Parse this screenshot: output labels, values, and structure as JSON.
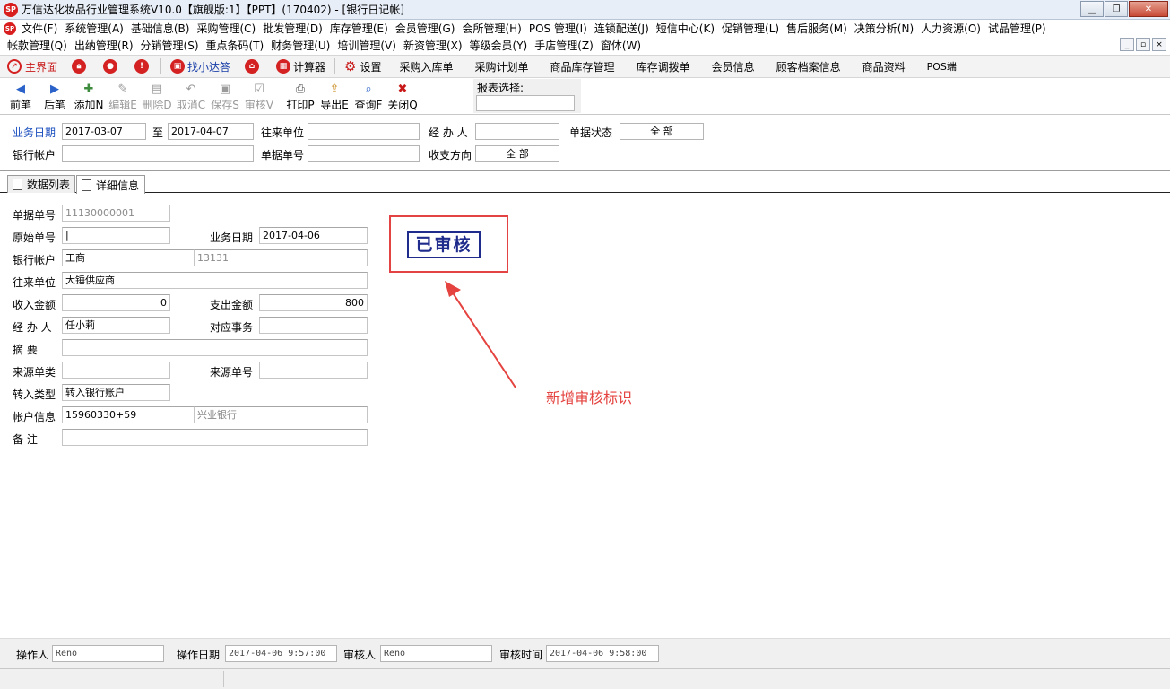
{
  "window": {
    "title": "万信达化妆品行业管理系统V10.0【旗舰版:1】【PPT】(170402) - [银行日记帐]",
    "logo_text": "SP",
    "min_glyph": "▁",
    "restore_glyph": "❐",
    "close_glyph": "✕"
  },
  "menu_row1": [
    "文件(F)",
    "系统管理(A)",
    "基础信息(B)",
    "采购管理(C)",
    "批发管理(D)",
    "库存管理(E)",
    "会员管理(G)",
    "会所管理(H)",
    "POS 管理(I)",
    "连锁配送(J)",
    "短信中心(K)",
    "促销管理(L)",
    "售后服务(M)",
    "决策分析(N)",
    "人力资源(O)",
    "试品管理(P)"
  ],
  "menu_row2": [
    "帐款管理(Q)",
    "出纳管理(R)",
    "分销管理(S)",
    "重点条码(T)",
    "财务管理(U)",
    "培训管理(V)",
    "新资管理(X)",
    "等级会员(Y)",
    "手店管理(Z)",
    "窗体(W)"
  ],
  "mdi": {
    "min": "_",
    "restore": "▫",
    "close": "×"
  },
  "quickbar": {
    "main": "主界面",
    "find": "找小达答",
    "calc": "计算器",
    "settings": "设置",
    "links": [
      "采购入库单",
      "采购计划单",
      "商品库存管理",
      "库存调拨单",
      "会员信息",
      "顾客档案信息",
      "商品资料",
      "POS端"
    ]
  },
  "toolbar": {
    "buttons": [
      {
        "label": "前笔",
        "icon": "◀",
        "enabled": true,
        "color": "#2a62c9"
      },
      {
        "label": "后笔",
        "icon": "▶",
        "enabled": true,
        "color": "#2a62c9"
      },
      {
        "label": "添加N",
        "icon": "✚",
        "enabled": true,
        "color": "#3d8b3d"
      },
      {
        "label": "编辑E",
        "icon": "✎",
        "enabled": false,
        "color": "#9a9a9a"
      },
      {
        "label": "删除D",
        "icon": "▤",
        "enabled": false,
        "color": "#9a9a9a"
      },
      {
        "label": "取消C",
        "icon": "↶",
        "enabled": false,
        "color": "#9a9a9a"
      },
      {
        "label": "保存S",
        "icon": "▣",
        "enabled": false,
        "color": "#9a9a9a"
      },
      {
        "label": "审核V",
        "icon": "☑",
        "enabled": false,
        "color": "#9a9a9a"
      },
      {
        "label": "打印P",
        "icon": "⎙",
        "enabled": true,
        "color": "#4a4a4a"
      },
      {
        "label": "导出E",
        "icon": "⇪",
        "enabled": true,
        "color": "#c98a1d"
      },
      {
        "label": "查询F",
        "icon": "⌕",
        "enabled": true,
        "color": "#2a62c9"
      },
      {
        "label": "关闭Q",
        "icon": "✖",
        "enabled": true,
        "color": "#c81818"
      }
    ],
    "report_label": "报表选择:"
  },
  "filters": {
    "date_label": "业务日期",
    "date_from": "2017-03-07",
    "to_label": "至",
    "date_to": "2017-04-07",
    "partner_label": "往来单位",
    "partner_value": "",
    "handler_label": "经 办 人",
    "handler_value": "",
    "status_label": "单据状态",
    "status_value": "全  部",
    "bank_label": "银行帐户",
    "bank_value": "",
    "docno_label": "单据单号",
    "docno_value": "",
    "direction_label": "收支方向",
    "direction_value": "全  部"
  },
  "tabs": [
    "数据列表",
    "详细信息"
  ],
  "detail": {
    "docno_label": "单据单号",
    "docno": "11130000001",
    "orig_label": "原始单号",
    "orig": "|",
    "bizdate_label": "业务日期",
    "bizdate": "2017-04-06",
    "bank_label": "银行帐户",
    "bank_name": "工商",
    "bank_no": "13131",
    "partner_label": "往来单位",
    "partner": "大锤供应商",
    "income_label": "收入金额",
    "income": "0",
    "expense_label": "支出金额",
    "expense": "800",
    "handler_label": "经 办 人",
    "handler": "任小莉",
    "matter_label": "对应事务",
    "matter": "",
    "summary_label": "摘    要",
    "summary": "",
    "srctype_label": "来源单类",
    "srctype": "",
    "srcno_label": "来源单号",
    "srcno": "",
    "transfer_label": "转入类型",
    "transfer": "转入银行账户",
    "acct_label": "帐户信息",
    "acct_no": "15960330+59",
    "acct_bank": "兴业银行",
    "remark_label": "备    注",
    "remark": ""
  },
  "stamp": "已审核",
  "annotation": "新增审核标识",
  "footer": {
    "operator_label": "操作人",
    "operator": "Reno",
    "opdate_label": "操作日期",
    "opdate": "2017-04-06 9:57:00",
    "auditor_label": "审核人",
    "auditor": "Reno",
    "audittime_label": "审核时间",
    "audittime": "2017-04-06 9:58:00"
  },
  "colors": {
    "accent_red": "#e4433f",
    "stamp_blue": "#1f2c8c",
    "label_blue": "#1b4fbf"
  }
}
